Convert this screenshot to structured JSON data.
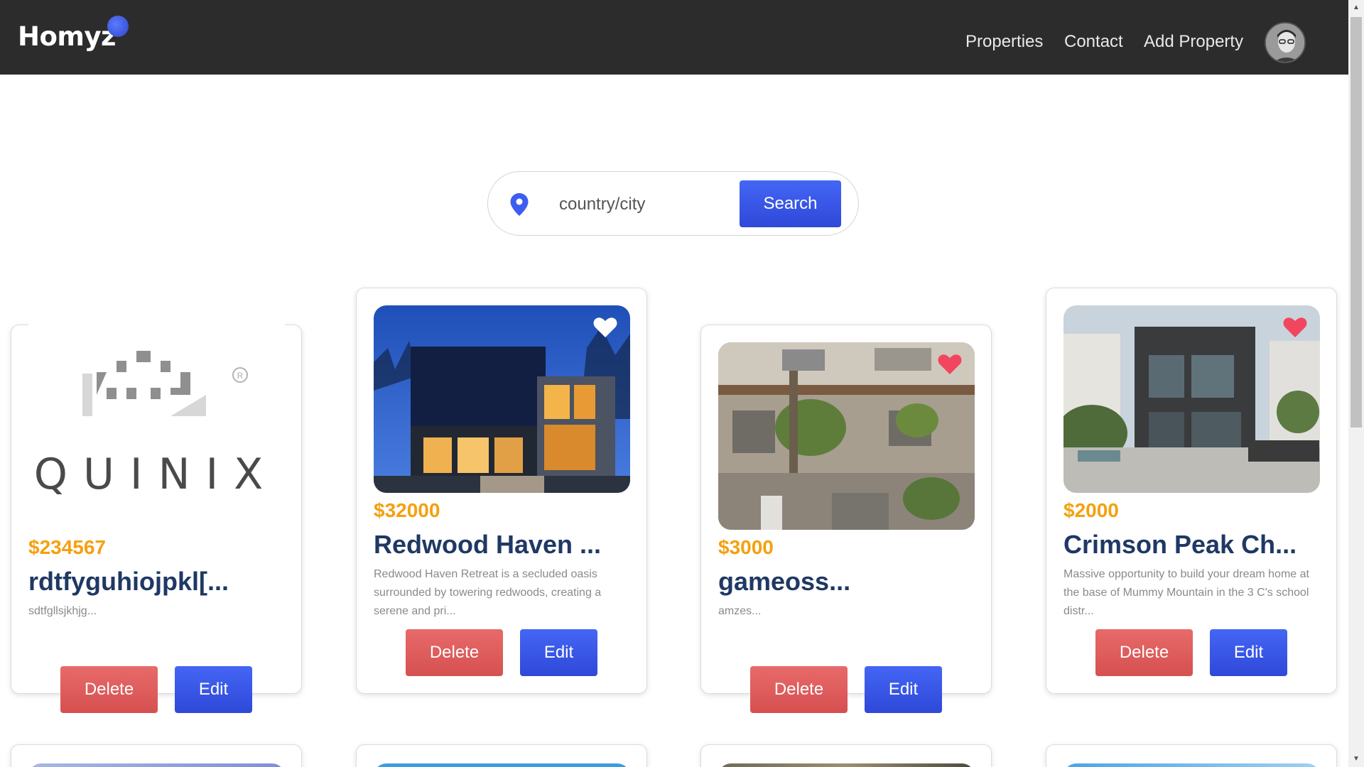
{
  "header": {
    "logo": "Homyz",
    "nav": [
      "Properties",
      "Contact",
      "Add Property"
    ]
  },
  "search": {
    "placeholder": "country/city",
    "button": "Search"
  },
  "cards": [
    {
      "price": "$234567",
      "title": "rdtfyguhiojpkl[...",
      "description": "sdtfgllsjkhjg...",
      "image": "equinix-logo",
      "image_text": "QUINIX",
      "favorite": "none",
      "delete_label": "Delete",
      "edit_label": "Edit"
    },
    {
      "price": "$32000",
      "title": "Redwood Haven ...",
      "description": "Redwood Haven Retreat is a secluded oasis surrounded by towering redwoods, creating a serene and pri...",
      "image": "modern-house-night",
      "favorite": "white",
      "delete_label": "Delete",
      "edit_label": "Edit"
    },
    {
      "price": "$3000",
      "title": "gameoss...",
      "description": "amzes...",
      "image": "old-building-vines",
      "favorite": "red",
      "delete_label": "Delete",
      "edit_label": "Edit"
    },
    {
      "price": "$2000",
      "title": "Crimson Peak Ch...",
      "description": "Massive opportunity to build your dream home at the base of Mummy Mountain in the 3 C's school distr...",
      "image": "modern-house-day",
      "favorite": "red",
      "delete_label": "Delete",
      "edit_label": "Edit"
    }
  ],
  "colors": {
    "header_bg": "#2d2c2c",
    "accent_blue": "#3a57e8",
    "price_orange": "#f5a010",
    "title_navy": "#1f3864",
    "delete_red": "#dd5a5a",
    "heart_red": "#f2455f"
  }
}
